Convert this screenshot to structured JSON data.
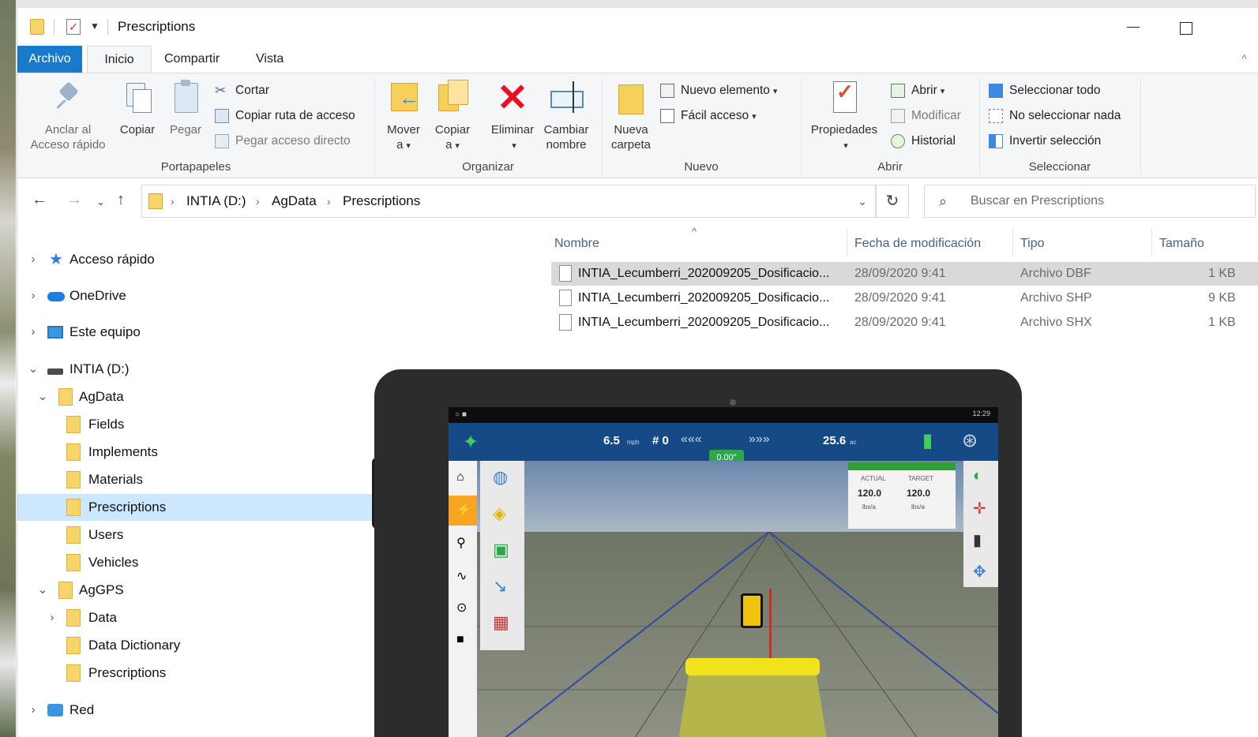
{
  "window": {
    "title": "Prescriptions"
  },
  "ribbon_tabs": [
    "Archivo",
    "Inicio",
    "Compartir",
    "Vista"
  ],
  "ribbon": {
    "portapapeles": {
      "label": "Portapapeles",
      "pin_line1": "Anclar al",
      "pin_line2": "Acceso rápido",
      "copy": "Copiar",
      "paste": "Pegar",
      "cut": "Cortar",
      "copy_path": "Copiar ruta de acceso",
      "paste_shortcut": "Pegar acceso directo"
    },
    "organizar": {
      "label": "Organizar",
      "move_line1": "Mover",
      "move_line2": "a",
      "copyto_line1": "Copiar",
      "copyto_line2": "a",
      "delete": "Eliminar",
      "rename_line1": "Cambiar",
      "rename_line2": "nombre"
    },
    "nuevo": {
      "label": "Nuevo",
      "newfolder_line1": "Nueva",
      "newfolder_line2": "carpeta",
      "new_item": "Nuevo elemento",
      "easy_access": "Fácil acceso"
    },
    "abrir": {
      "label": "Abrir",
      "properties": "Propiedades",
      "open": "Abrir",
      "edit": "Modificar",
      "history": "Historial"
    },
    "seleccionar": {
      "label": "Seleccionar",
      "select_all": "Seleccionar todo",
      "select_none": "No seleccionar nada",
      "invert": "Invertir selección"
    }
  },
  "address": {
    "crumbs": [
      "INTIA (D:)",
      "AgData",
      "Prescriptions"
    ],
    "search_placeholder": "Buscar en Prescriptions"
  },
  "nav_tree": [
    {
      "label": "Acceso rápido"
    },
    {
      "label": "OneDrive"
    },
    {
      "label": "Este equipo"
    },
    {
      "label": "INTIA (D:)"
    },
    {
      "label": "AgData"
    },
    {
      "label": "Fields"
    },
    {
      "label": "Implements"
    },
    {
      "label": "Materials"
    },
    {
      "label": "Prescriptions"
    },
    {
      "label": "Users"
    },
    {
      "label": "Vehicles"
    },
    {
      "label": "AgGPS"
    },
    {
      "label": "Data"
    },
    {
      "label": "Data Dictionary"
    },
    {
      "label": "Prescriptions"
    },
    {
      "label": "Red"
    }
  ],
  "columns": [
    "Nombre",
    "Fecha de modificación",
    "Tipo",
    "Tamaño"
  ],
  "files": [
    {
      "name": "INTIA_Lecumberri_202009205_Dosificacio...",
      "date": "28/09/2020 9:41",
      "type": "Archivo DBF",
      "size": "1 KB"
    },
    {
      "name": "INTIA_Lecumberri_202009205_Dosificacio...",
      "date": "28/09/2020 9:41",
      "type": "Archivo SHP",
      "size": "9 KB"
    },
    {
      "name": "INTIA_Lecumberri_202009205_Dosificacio...",
      "date": "28/09/2020 9:41",
      "type": "Archivo SHX",
      "size": "1 KB"
    }
  ],
  "tablet": {
    "speed": "6.5",
    "speed_unit": "mph",
    "row_num": "# 0",
    "offset": "0.00\"",
    "area": "25.6",
    "area_unit": "ac",
    "clock": "12:29",
    "actual_label": "ACTUAL",
    "target_label": "TARGET",
    "actual_value": "120.0",
    "target_value": "120.0",
    "rate_unit": "lbs/a"
  },
  "colors": {
    "accent": "#1979ca",
    "selection": "#cce8ff",
    "folder": "#f8d56b"
  }
}
